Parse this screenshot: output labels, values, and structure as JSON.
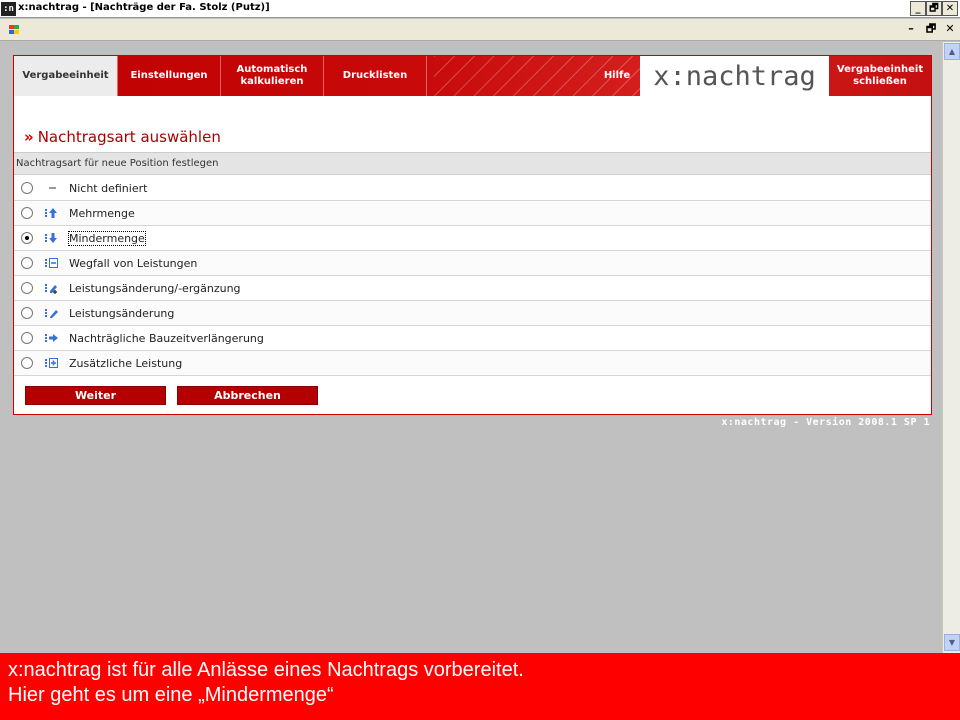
{
  "window": {
    "app_icon": ":n",
    "title": "x:nachtrag - [Nachträge der Fa. Stolz (Putz)]",
    "minimize": "_",
    "restore": "🗗",
    "close": "✕"
  },
  "mdi": {
    "minimize": "–",
    "restore": "🗗",
    "close": "✕"
  },
  "nav": {
    "items": [
      {
        "label": "Vergabeeinheit",
        "active": true
      },
      {
        "label": "Einstellungen"
      },
      {
        "label": "Automatisch kalkulieren"
      },
      {
        "label": "Drucklisten"
      },
      {
        "label": "Hilfe"
      }
    ],
    "logo": "x:nachtrag",
    "close_label": "Vergabeeinheit schließen"
  },
  "page": {
    "heading_chevron": "»",
    "heading": "Nachtragsart auswählen",
    "section_label": "Nachtragsart für neue Position festlegen"
  },
  "options": [
    {
      "label": "Nicht definiert",
      "icon": "dash-icon",
      "checked": false
    },
    {
      "label": "Mehrmenge",
      "icon": "arrow-up-icon",
      "checked": false
    },
    {
      "label": "Mindermenge",
      "icon": "arrow-down-icon",
      "checked": true
    },
    {
      "label": "Wegfall von Leistungen",
      "icon": "minus-box-icon",
      "checked": false
    },
    {
      "label": "Leistungsänderung/-ergänzung",
      "icon": "edit-plus-icon",
      "checked": false
    },
    {
      "label": "Leistungsänderung",
      "icon": "pencil-icon",
      "checked": false
    },
    {
      "label": "Nachträgliche Bauzeitverlängerung",
      "icon": "arrow-right-icon",
      "checked": false
    },
    {
      "label": "Zusätzliche Leistung",
      "icon": "plus-box-icon",
      "checked": false
    }
  ],
  "buttons": {
    "next": "Weiter",
    "cancel": "Abbrechen"
  },
  "version": "x:nachtrag - Version 2008.1 SP 1",
  "caption": {
    "line1": "x:nachtrag ist für alle Anlässe eines Nachtrags vorbereitet.",
    "line2": "Hier geht es um eine „Mindermenge“"
  },
  "colors": {
    "accent": "#c00000",
    "button": "#b40000",
    "caption": "#ff0000",
    "icon_blue": "#3a6fd8"
  }
}
